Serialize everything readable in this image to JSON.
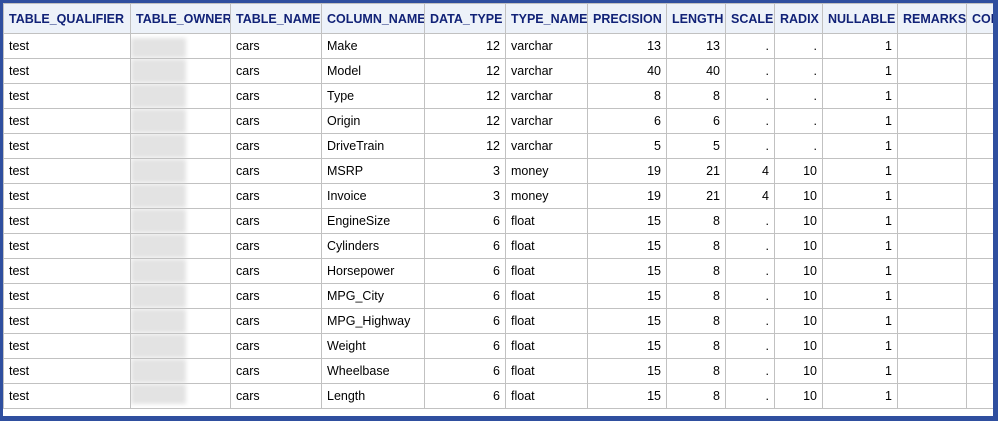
{
  "columns": [
    "TABLE_QUALIFIER",
    "TABLE_OWNER",
    "TABLE_NAME",
    "COLUMN_NAME",
    "DATA_TYPE",
    "TYPE_NAME",
    "PRECISION",
    "LENGTH",
    "SCALE",
    "RADIX",
    "NULLABLE",
    "REMARKS",
    "COLU"
  ],
  "rows": [
    {
      "table_qualifier": "test",
      "table_owner": "",
      "table_name": "cars",
      "column_name": "Make",
      "data_type": "12",
      "type_name": "varchar",
      "precision": "13",
      "length": "13",
      "scale": ".",
      "radix": ".",
      "nullable": "1",
      "remarks": "",
      "colu": ""
    },
    {
      "table_qualifier": "test",
      "table_owner": "",
      "table_name": "cars",
      "column_name": "Model",
      "data_type": "12",
      "type_name": "varchar",
      "precision": "40",
      "length": "40",
      "scale": ".",
      "radix": ".",
      "nullable": "1",
      "remarks": "",
      "colu": ""
    },
    {
      "table_qualifier": "test",
      "table_owner": "",
      "table_name": "cars",
      "column_name": "Type",
      "data_type": "12",
      "type_name": "varchar",
      "precision": "8",
      "length": "8",
      "scale": ".",
      "radix": ".",
      "nullable": "1",
      "remarks": "",
      "colu": ""
    },
    {
      "table_qualifier": "test",
      "table_owner": "",
      "table_name": "cars",
      "column_name": "Origin",
      "data_type": "12",
      "type_name": "varchar",
      "precision": "6",
      "length": "6",
      "scale": ".",
      "radix": ".",
      "nullable": "1",
      "remarks": "",
      "colu": ""
    },
    {
      "table_qualifier": "test",
      "table_owner": "",
      "table_name": "cars",
      "column_name": "DriveTrain",
      "data_type": "12",
      "type_name": "varchar",
      "precision": "5",
      "length": "5",
      "scale": ".",
      "radix": ".",
      "nullable": "1",
      "remarks": "",
      "colu": ""
    },
    {
      "table_qualifier": "test",
      "table_owner": "",
      "table_name": "cars",
      "column_name": "MSRP",
      "data_type": "3",
      "type_name": "money",
      "precision": "19",
      "length": "21",
      "scale": "4",
      "radix": "10",
      "nullable": "1",
      "remarks": "",
      "colu": ""
    },
    {
      "table_qualifier": "test",
      "table_owner": "",
      "table_name": "cars",
      "column_name": "Invoice",
      "data_type": "3",
      "type_name": "money",
      "precision": "19",
      "length": "21",
      "scale": "4",
      "radix": "10",
      "nullable": "1",
      "remarks": "",
      "colu": ""
    },
    {
      "table_qualifier": "test",
      "table_owner": "",
      "table_name": "cars",
      "column_name": "EngineSize",
      "data_type": "6",
      "type_name": "float",
      "precision": "15",
      "length": "8",
      "scale": ".",
      "radix": "10",
      "nullable": "1",
      "remarks": "",
      "colu": ""
    },
    {
      "table_qualifier": "test",
      "table_owner": "",
      "table_name": "cars",
      "column_name": "Cylinders",
      "data_type": "6",
      "type_name": "float",
      "precision": "15",
      "length": "8",
      "scale": ".",
      "radix": "10",
      "nullable": "1",
      "remarks": "",
      "colu": ""
    },
    {
      "table_qualifier": "test",
      "table_owner": "",
      "table_name": "cars",
      "column_name": "Horsepower",
      "data_type": "6",
      "type_name": "float",
      "precision": "15",
      "length": "8",
      "scale": ".",
      "radix": "10",
      "nullable": "1",
      "remarks": "",
      "colu": ""
    },
    {
      "table_qualifier": "test",
      "table_owner": "",
      "table_name": "cars",
      "column_name": "MPG_City",
      "data_type": "6",
      "type_name": "float",
      "precision": "15",
      "length": "8",
      "scale": ".",
      "radix": "10",
      "nullable": "1",
      "remarks": "",
      "colu": ""
    },
    {
      "table_qualifier": "test",
      "table_owner": "",
      "table_name": "cars",
      "column_name": "MPG_Highway",
      "data_type": "6",
      "type_name": "float",
      "precision": "15",
      "length": "8",
      "scale": ".",
      "radix": "10",
      "nullable": "1",
      "remarks": "",
      "colu": ""
    },
    {
      "table_qualifier": "test",
      "table_owner": "",
      "table_name": "cars",
      "column_name": "Weight",
      "data_type": "6",
      "type_name": "float",
      "precision": "15",
      "length": "8",
      "scale": ".",
      "radix": "10",
      "nullable": "1",
      "remarks": "",
      "colu": ""
    },
    {
      "table_qualifier": "test",
      "table_owner": "",
      "table_name": "cars",
      "column_name": "Wheelbase",
      "data_type": "6",
      "type_name": "float",
      "precision": "15",
      "length": "8",
      "scale": ".",
      "radix": "10",
      "nullable": "1",
      "remarks": "",
      "colu": ""
    },
    {
      "table_qualifier": "test",
      "table_owner": "",
      "table_name": "cars",
      "column_name": "Length",
      "data_type": "6",
      "type_name": "float",
      "precision": "15",
      "length": "8",
      "scale": ".",
      "radix": "10",
      "nullable": "1",
      "remarks": "",
      "colu": ""
    }
  ],
  "colors": {
    "frame_border": "#2f4f9f",
    "header_background": "#edf2f9",
    "header_text": "#112277",
    "grid_line": "#c1c1c1",
    "redaction": "#e3e3e3"
  }
}
